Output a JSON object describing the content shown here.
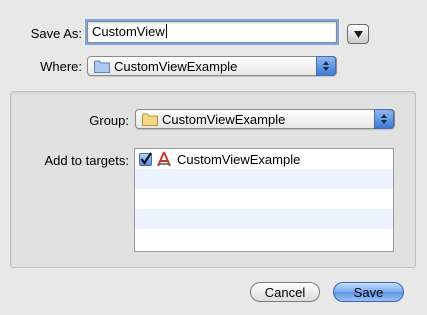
{
  "save_as": {
    "label": "Save As:",
    "value": "CustomView"
  },
  "where": {
    "label": "Where:",
    "selected": "CustomViewExample",
    "icon": "folder-icon"
  },
  "group": {
    "label": "Group:",
    "selected": "CustomViewExample",
    "icon": "folder-icon"
  },
  "targets": {
    "label": "Add to targets:",
    "items": [
      {
        "label": "CustomViewExample",
        "checked": true,
        "icon": "app-target-icon"
      }
    ]
  },
  "buttons": {
    "cancel": "Cancel",
    "save": "Save"
  },
  "colors": {
    "accent": "#5c94e6",
    "folder_blue": "#9fc3ec",
    "folder_yellow": "#f2d27a"
  }
}
